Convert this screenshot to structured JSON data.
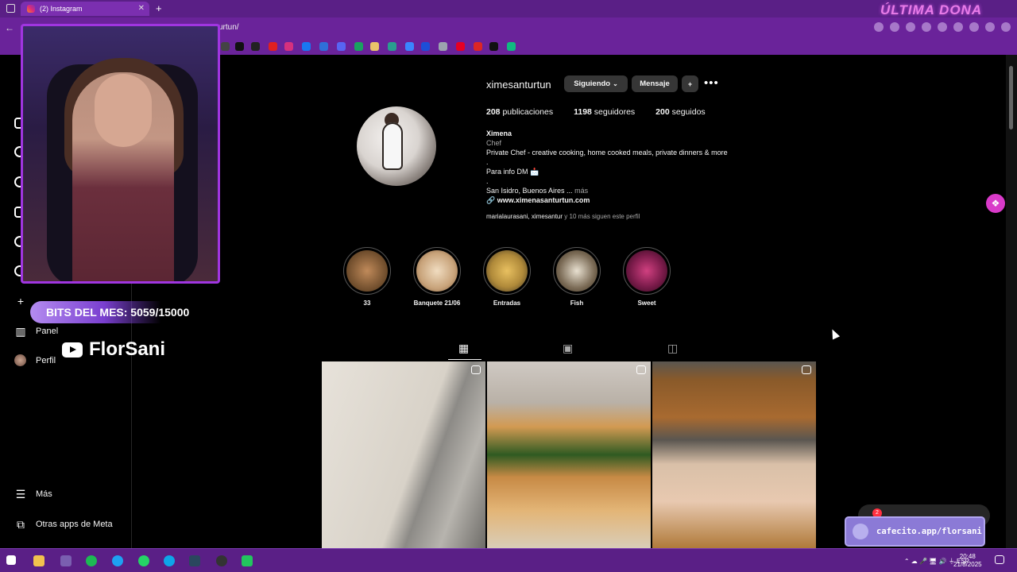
{
  "browser": {
    "tab_title": "(2) Instagram",
    "url": "urtun/",
    "overlay_brand": "ÚLTIMA DONA"
  },
  "sidebar": {
    "panel": "Panel",
    "profile": "Perfil",
    "more": "Más",
    "meta_apps": "Otras apps de Meta"
  },
  "profile": {
    "username": "ximesanturtun",
    "following_button": "Siguiendo",
    "message_button": "Mensaje",
    "stats": [
      {
        "count": "208",
        "label": "publicaciones"
      },
      {
        "count": "1198",
        "label": "seguidores"
      },
      {
        "count": "200",
        "label": "seguidos"
      }
    ],
    "name": "Ximena",
    "category": "Chef",
    "bio_line1": "Private Chef - creative cooking, home cooked meals, private dinners & more",
    "bio_dot1": ".",
    "bio_line2": "Para info DM 📩",
    "bio_dot2": ".",
    "bio_line3": "San Isidro, Buenos Aires ...",
    "bio_more": "más",
    "website": "www.ximenasanturtun.com",
    "followed_by_names": "marialaurasani, ximesantur",
    "followed_by_rest": "y 10 más siguen este perfil"
  },
  "highlights": [
    {
      "label": "33",
      "color": "#6b4a2a"
    },
    {
      "label": "Banquete 21/06",
      "color": "#c8a37a"
    },
    {
      "label": "Entradas",
      "color": "#b08a3a"
    },
    {
      "label": "Fish",
      "color": "#7a6a55"
    },
    {
      "label": "Sweet",
      "color": "#7a1b4a"
    }
  ],
  "overlay": {
    "bits": "BITS DEL MES:  5059/15000",
    "bits_progress": 0.337,
    "youtube": "FlorSani",
    "cafecito": "cafecito.app/florsani"
  },
  "messages": {
    "badge": "2"
  },
  "taskbar": {
    "lang": "ESP",
    "time": "20:48",
    "date": "21/8/2025"
  }
}
